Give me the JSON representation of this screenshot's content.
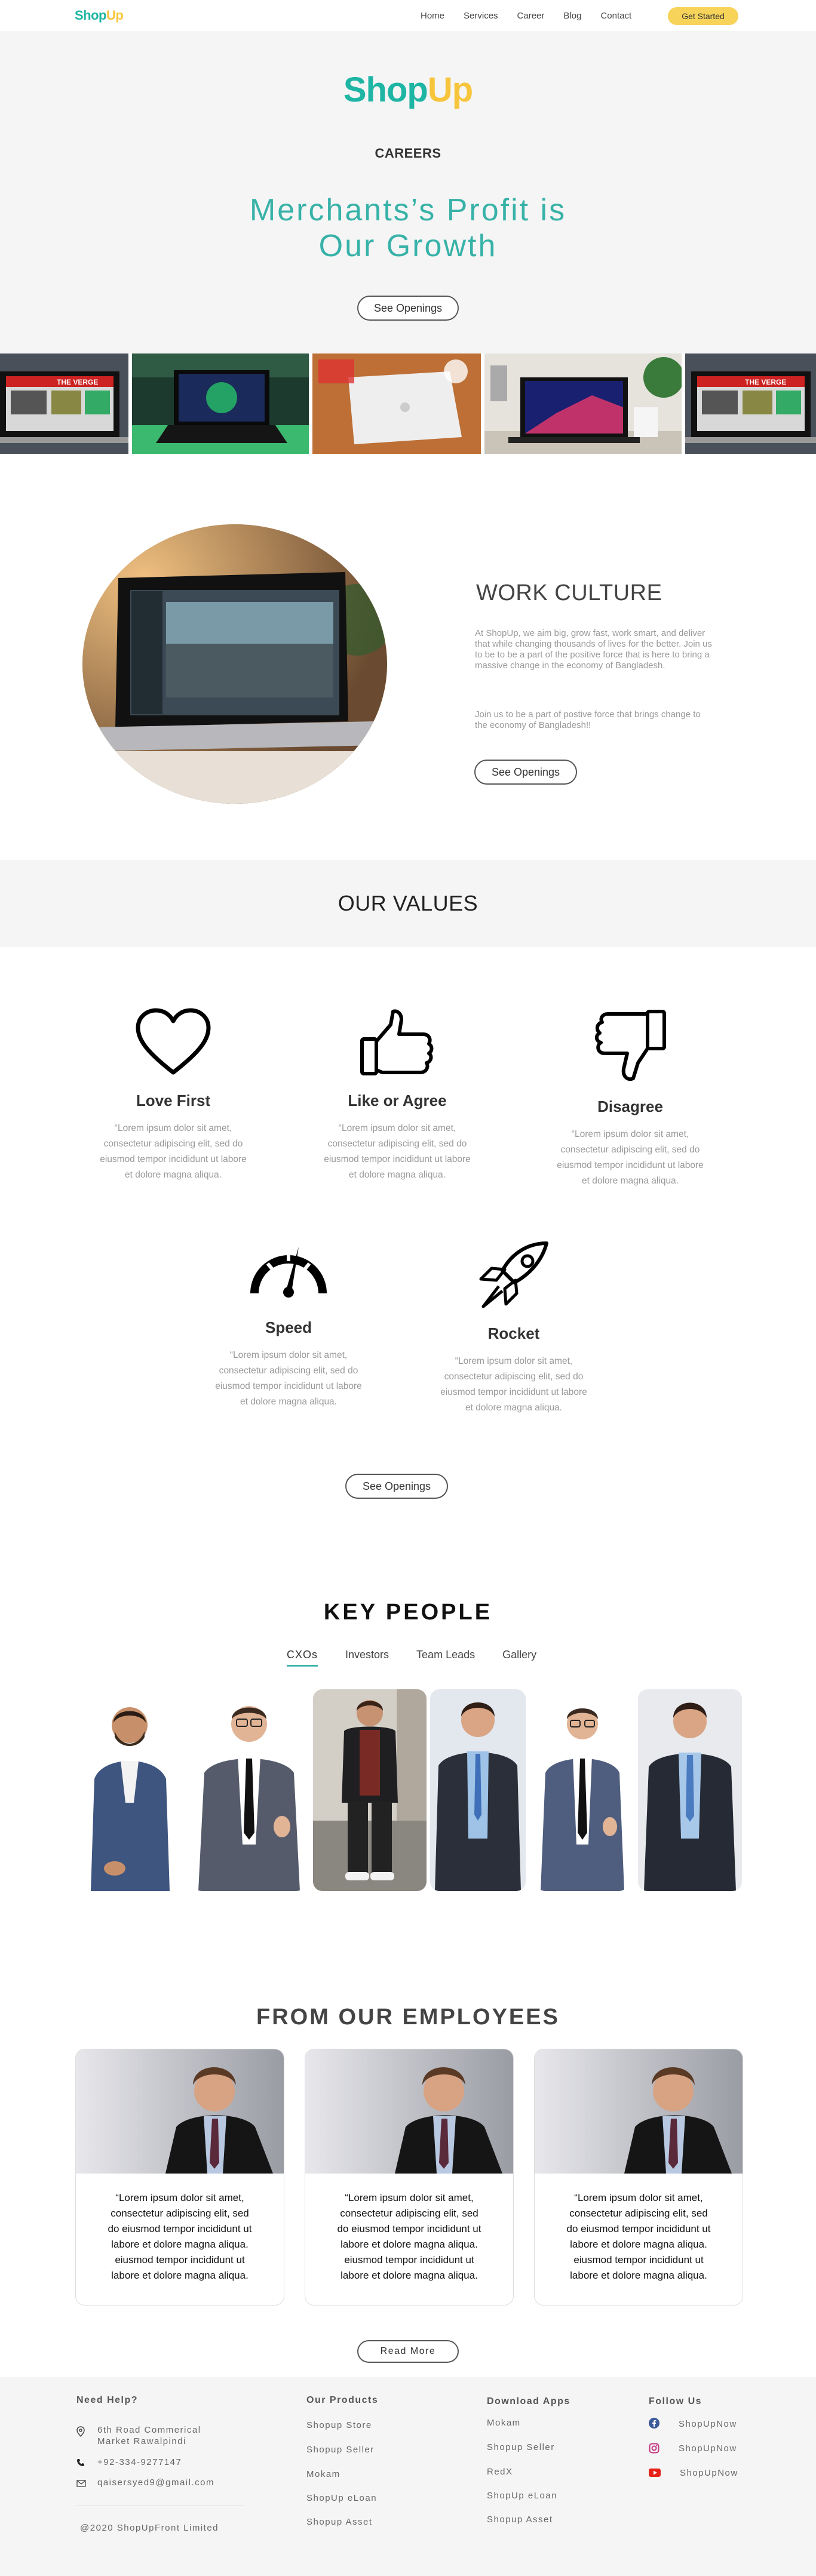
{
  "nav": {
    "logo_shop": "Shop",
    "logo_up": "Up",
    "links": [
      "Home",
      "Services",
      "Career",
      "Blog",
      "Contact"
    ],
    "cta": "Get Started"
  },
  "hero": {
    "logo_shop": "Shop",
    "logo_up": "Up",
    "subtitle": "CAREERS",
    "title_line1": "Merchants’s Profit is",
    "title_line2": "Our Growth",
    "button": "See Openings"
  },
  "culture": {
    "title": "WORK CULTURE",
    "paragraph1": "At ShopUp, we aim big, grow fast, work smart, and deliver that while changing thousands of lives for the better. Join us to be to be a part of the positive force that is here to bring a massive change in the economy of Bangladesh.",
    "paragraph2": "Join us to be a part of postive force that brings change to the economy of Bangladesh!!",
    "button": "See Openings"
  },
  "values": {
    "title": "OUR VALUES",
    "items": [
      {
        "name": "Love First",
        "icon": "heart-icon",
        "text": "“Lorem ipsum dolor sit amet, consectetur adipiscing elit, sed do eiusmod tempor incididunt ut labore et dolore magna aliqua."
      },
      {
        "name": "Like or Agree",
        "icon": "thumbs-up-icon",
        "text": "“Lorem ipsum dolor sit amet, consectetur adipiscing elit, sed do eiusmod tempor incididunt ut labore et dolore magna aliqua."
      },
      {
        "name": "Disagree",
        "icon": "thumbs-down-icon",
        "text": "“Lorem ipsum dolor sit amet, consectetur adipiscing elit, sed do eiusmod tempor incididunt ut labore et dolore magna aliqua."
      },
      {
        "name": "Speed",
        "icon": "speedometer-icon",
        "text": "“Lorem ipsum dolor sit amet, consectetur adipiscing elit, sed do eiusmod tempor incididunt ut labore et dolore magna aliqua."
      },
      {
        "name": "Rocket",
        "icon": "rocket-icon",
        "text": "“Lorem ipsum dolor sit amet, consectetur adipiscing elit, sed do eiusmod tempor incididunt ut labore et dolore magna aliqua."
      }
    ],
    "button": "See Openings"
  },
  "people": {
    "title": "KEY PEOPLE",
    "tabs": [
      "CXOs",
      "Investors",
      "Team Leads",
      "Gallery"
    ]
  },
  "employees": {
    "title": "FROM OUR EMPLOYEES",
    "quotes": [
      "“Lorem ipsum dolor sit amet, consectetur adipiscing elit, sed do eiusmod tempor incididunt ut labore et dolore magna aliqua. eiusmod tempor incididunt ut labore et dolore magna aliqua.",
      "“Lorem ipsum dolor sit amet, consectetur adipiscing elit, sed do eiusmod tempor incididunt ut labore et dolore magna aliqua. eiusmod tempor incididunt ut labore et dolore magna aliqua.",
      "“Lorem ipsum dolor sit amet, consectetur adipiscing elit, sed do eiusmod tempor incididunt ut labore et dolore magna aliqua. eiusmod tempor incididunt ut labore et dolore magna aliqua."
    ],
    "button": "Read More"
  },
  "footer": {
    "help_title": "Need Help?",
    "address": "6th Road Commerical Market Rawalpindi",
    "phone": "+92-334-9277147",
    "email": "qaisersyed9@gmail.com",
    "copyright": "@2020 ShopUpFront Limited",
    "products_title": "Our Products",
    "products": [
      "Shopup Store",
      "Shopup Seller",
      "Mokam",
      "ShopUp eLoan",
      "Shopup Asset"
    ],
    "apps_title": "Download Apps",
    "apps": [
      "Mokam",
      "Shopup Seller",
      "RedX",
      "ShopUp eLoan",
      "Shopup Asset"
    ],
    "follow_title": "Follow Us",
    "social": [
      {
        "label": "ShopUpNow",
        "icon": "facebook-icon",
        "color": "#3b5998"
      },
      {
        "label": "ShopUpNow",
        "icon": "instagram-icon",
        "color": "#c13584"
      },
      {
        "label": "ShopUpNow",
        "icon": "youtube-icon",
        "color": "#e62117"
      }
    ]
  },
  "colors": {
    "brand_teal": "#38b2a8",
    "brand_yellow": "#f6c53b",
    "cta_yellow": "#f7d35a"
  }
}
